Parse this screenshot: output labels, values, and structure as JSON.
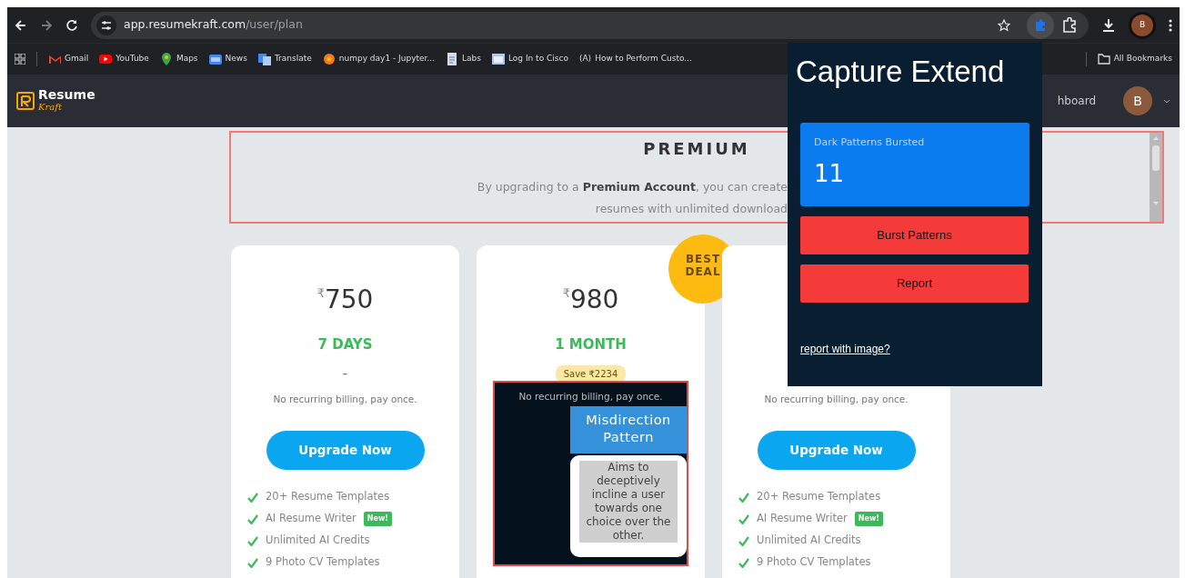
{
  "browser": {
    "url_host": "app.resumekraft.com",
    "url_path": "/user/plan",
    "profile_initial": "B",
    "bookmarks": [
      {
        "kind": "mail",
        "label": "Gmail"
      },
      {
        "kind": "video",
        "label": "YouTube"
      },
      {
        "kind": "pin",
        "label": "Maps"
      },
      {
        "kind": "news",
        "label": "News"
      },
      {
        "kind": "translate",
        "label": "Translate"
      },
      {
        "kind": "notebook",
        "label": "numpy day1 - Jupyter..."
      },
      {
        "kind": "doc",
        "label": "Labs"
      },
      {
        "kind": "page",
        "label": "Log In to Cisco"
      },
      {
        "kind": "letter",
        "label": "How to Perform Custo...",
        "glyph": "(A)"
      }
    ],
    "all_bookmarks": "All Bookmarks"
  },
  "site": {
    "logo_title": "Resume",
    "logo_sub": "Kraft",
    "nav_link": "hboard",
    "avatar": "B"
  },
  "premium": {
    "title": "PREMIUM",
    "lines": [
      "By upgrading to a **Premium Account**, you can create",
      "resumes with unlimited download"
    ]
  },
  "plans": [
    {
      "currency": "₹",
      "price": "750",
      "period": "7 DAYS",
      "dash": "-",
      "billing": "No recurring billing, pay once.",
      "button": "Upgrade Now",
      "features": [
        {
          "text": "20+ Resume Templates"
        },
        {
          "text": "AI Resume Writer",
          "badge": "New!"
        },
        {
          "text": "Unlimited AI Credits"
        },
        {
          "text": "9 Photo CV Templates"
        }
      ]
    },
    {
      "currency": "₹",
      "price": "980",
      "period": "1 MONTH",
      "save": "Save ₹2234",
      "ribbon": "BEST DEAL",
      "overlay": {
        "billing": "No recurring billing, pay once.",
        "label": "Misdirection Pattern",
        "description": "Aims to deceptively incline a user towards one choice over the other."
      }
    },
    {
      "billing": "No recurring billing, pay once.",
      "button": "Upgrade Now",
      "features": [
        {
          "text": "20+ Resume Templates"
        },
        {
          "text": "AI Resume Writer",
          "badge": "New!"
        },
        {
          "text": "Unlimited AI Credits"
        },
        {
          "text": "9 Photo CV Templates"
        }
      ]
    }
  ],
  "popup": {
    "title": "Capture Extend",
    "stat_label": "Dark Patterns Bursted",
    "stat_value": "11",
    "buttons": [
      "Burst Patterns",
      "Report"
    ],
    "link": "report with image?"
  }
}
